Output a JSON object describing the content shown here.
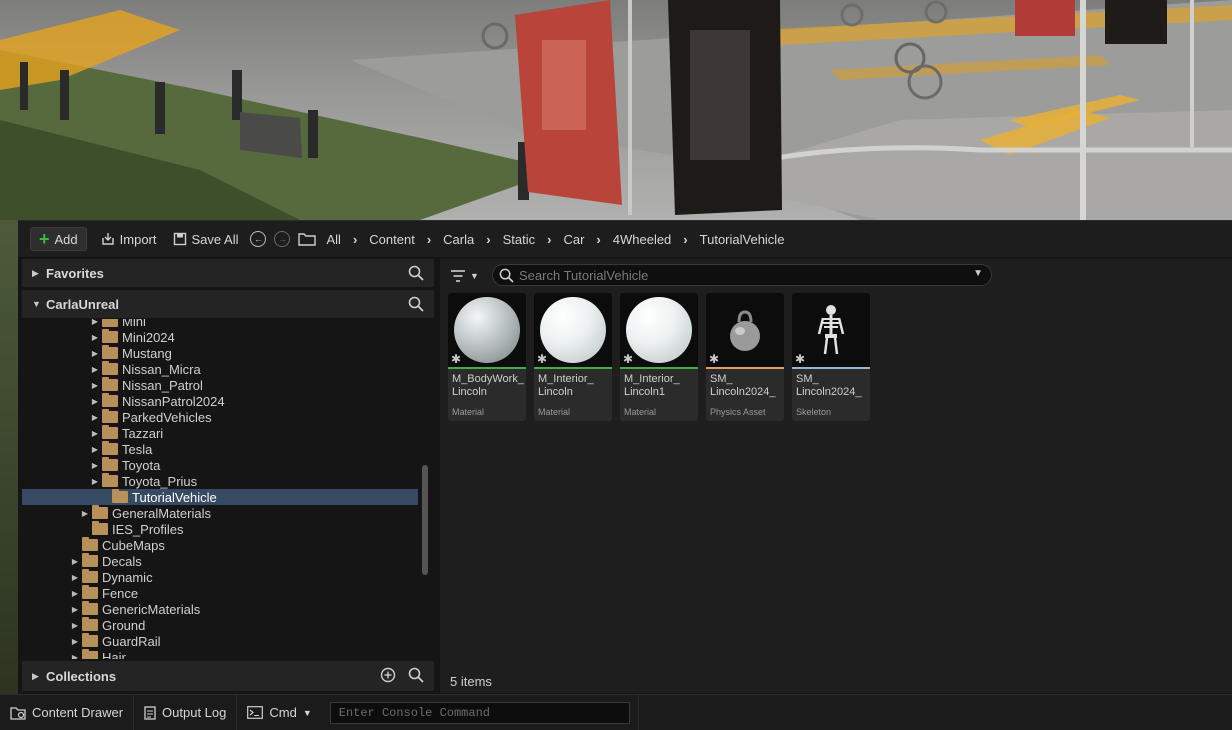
{
  "toolbar": {
    "add_label": "Add",
    "import_label": "Import",
    "save_all_label": "Save All",
    "breadcrumbs": [
      "All",
      "Content",
      "Carla",
      "Static",
      "Car",
      "4Wheeled",
      "TutorialVehicle"
    ]
  },
  "left_pane": {
    "favorites_label": "Favorites",
    "root_label": "CarlaUnreal",
    "collections_label": "Collections",
    "tree": [
      {
        "label": "Mini",
        "expandable": true
      },
      {
        "label": "Mini2024",
        "expandable": true
      },
      {
        "label": "Mustang",
        "expandable": true
      },
      {
        "label": "Nissan_Micra",
        "expandable": true
      },
      {
        "label": "Nissan_Patrol",
        "expandable": true
      },
      {
        "label": "NissanPatrol2024",
        "expandable": true
      },
      {
        "label": "ParkedVehicles",
        "expandable": true
      },
      {
        "label": "Tazzari",
        "expandable": true
      },
      {
        "label": "Tesla",
        "expandable": true
      },
      {
        "label": "Toyota",
        "expandable": true
      },
      {
        "label": "Toyota_Prius",
        "expandable": true
      },
      {
        "label": "TutorialVehicle",
        "expandable": false,
        "selected": true
      },
      {
        "label": "GeneralMaterials",
        "expandable": true
      },
      {
        "label": "IES_Profiles",
        "expandable": false
      },
      {
        "label": "CubeMaps",
        "expandable": false
      },
      {
        "label": "Decals",
        "expandable": true
      },
      {
        "label": "Dynamic",
        "expandable": true
      },
      {
        "label": "Fence",
        "expandable": true
      },
      {
        "label": "GenericMaterials",
        "expandable": true
      },
      {
        "label": "Ground",
        "expandable": true
      },
      {
        "label": "GuardRail",
        "expandable": true
      },
      {
        "label": "Hair",
        "expandable": true
      }
    ]
  },
  "right_pane": {
    "search_placeholder": "Search TutorialVehicle",
    "items_count": "5 items",
    "assets": [
      {
        "name": "M_BodyWork_\nLincoln",
        "type": "Material",
        "bar_color": "#3fae44",
        "thumb": "sphere-gray"
      },
      {
        "name": "M_Interior_\nLincoln",
        "type": "Material",
        "bar_color": "#3fae44",
        "thumb": "sphere-white"
      },
      {
        "name": "M_Interior_\nLincoln1",
        "type": "Material",
        "bar_color": "#3fae44",
        "thumb": "sphere-white"
      },
      {
        "name": "SM_\nLincoln2024_",
        "type": "Physics Asset",
        "bar_color": "#e2a05b",
        "thumb": "weight-icon"
      },
      {
        "name": "SM_\nLincoln2024_",
        "type": "Skeleton",
        "bar_color": "#8fb8d8",
        "thumb": "skeleton-icon"
      }
    ]
  },
  "statusbar": {
    "content_drawer_label": "Content Drawer",
    "output_log_label": "Output Log",
    "cmd_label": "Cmd",
    "console_placeholder": "Enter Console Command"
  }
}
